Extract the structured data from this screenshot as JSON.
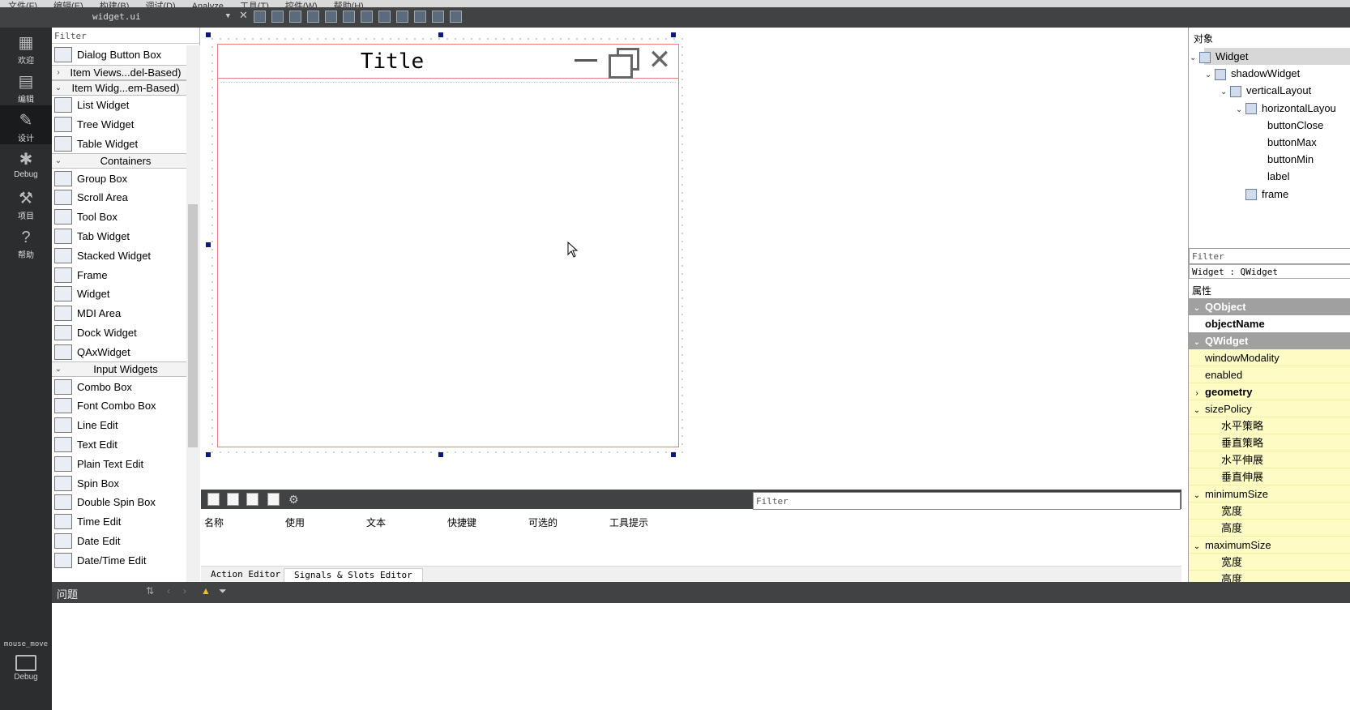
{
  "menubar": {
    "items": [
      "文件(F)",
      "编辑(E)",
      "构建(B)",
      "调试(D)",
      "Analyze",
      "工具(T)",
      "控件(W)",
      "帮助(H)"
    ]
  },
  "toolbar": {
    "file": "widget.ui",
    "close": "✕"
  },
  "modes": [
    {
      "label": "欢迎",
      "icon": "grid-icon"
    },
    {
      "label": "编辑",
      "icon": "edit-doc-icon"
    },
    {
      "label": "设计",
      "icon": "pencil-icon"
    },
    {
      "label": "Debug",
      "icon": "bug-icon"
    },
    {
      "label": "项目",
      "icon": "wrench-icon"
    },
    {
      "label": "帮助",
      "icon": "help-icon"
    }
  ],
  "target": {
    "project": "mouse_move",
    "config": "Debug"
  },
  "widgetbox": {
    "filter": "Filter",
    "items": [
      {
        "type": "item",
        "label": "Dialog Button Box"
      },
      {
        "type": "cat",
        "label": "Item Views...del-Based)",
        "collapsed": true
      },
      {
        "type": "cat",
        "label": "Item Widg...em-Based)",
        "collapsed": false
      },
      {
        "type": "item",
        "label": "List Widget"
      },
      {
        "type": "item",
        "label": "Tree Widget"
      },
      {
        "type": "item",
        "label": "Table Widget"
      },
      {
        "type": "cat",
        "label": "Containers",
        "collapsed": false
      },
      {
        "type": "item",
        "label": "Group Box"
      },
      {
        "type": "item",
        "label": "Scroll Area"
      },
      {
        "type": "item",
        "label": "Tool Box"
      },
      {
        "type": "item",
        "label": "Tab Widget"
      },
      {
        "type": "item",
        "label": "Stacked Widget"
      },
      {
        "type": "item",
        "label": "Frame"
      },
      {
        "type": "item",
        "label": "Widget"
      },
      {
        "type": "item",
        "label": "MDI Area"
      },
      {
        "type": "item",
        "label": "Dock Widget"
      },
      {
        "type": "item",
        "label": "QAxWidget"
      },
      {
        "type": "cat",
        "label": "Input Widgets",
        "collapsed": false
      },
      {
        "type": "item",
        "label": "Combo Box"
      },
      {
        "type": "item",
        "label": "Font Combo Box"
      },
      {
        "type": "item",
        "label": "Line Edit"
      },
      {
        "type": "item",
        "label": "Text Edit"
      },
      {
        "type": "item",
        "label": "Plain Text Edit"
      },
      {
        "type": "item",
        "label": "Spin Box"
      },
      {
        "type": "item",
        "label": "Double Spin Box"
      },
      {
        "type": "item",
        "label": "Time Edit"
      },
      {
        "type": "item",
        "label": "Date Edit"
      },
      {
        "type": "item",
        "label": "Date/Time Edit"
      }
    ]
  },
  "form": {
    "title": "Title"
  },
  "action_editor": {
    "filter": "Filter",
    "columns": [
      "名称",
      "使用",
      "文本",
      "快捷键",
      "可选的",
      "工具提示"
    ],
    "tabs": [
      "Action Editor",
      "Signals & Slots Editor"
    ]
  },
  "object_inspector": {
    "header": "对象",
    "tree": [
      {
        "label": "Widget",
        "depth": 0,
        "chevron": "v",
        "selected": true
      },
      {
        "label": "shadowWidget",
        "depth": 1,
        "chevron": "v"
      },
      {
        "label": "verticalLayout",
        "depth": 2,
        "chevron": "v"
      },
      {
        "label": "horizontalLayou",
        "depth": 3,
        "chevron": "v"
      },
      {
        "label": "buttonClose",
        "depth": 4
      },
      {
        "label": "buttonMax",
        "depth": 4
      },
      {
        "label": "buttonMin",
        "depth": 4
      },
      {
        "label": "label",
        "depth": 4
      },
      {
        "label": "frame",
        "depth": 3
      }
    ]
  },
  "property_editor": {
    "filter": "Filter",
    "class_line": "Widget : QWidget",
    "header": "属性",
    "rows": [
      {
        "label": "QObject",
        "kind": "group"
      },
      {
        "label": "objectName",
        "kind": "bold"
      },
      {
        "label": "QWidget",
        "kind": "group"
      },
      {
        "label": "windowModality",
        "kind": "yellow"
      },
      {
        "label": "enabled",
        "kind": "yellow"
      },
      {
        "label": "geometry",
        "kind": "yellow-bold",
        "chevron": ">"
      },
      {
        "label": "sizePolicy",
        "kind": "yellow",
        "chevron": "v"
      },
      {
        "label": "水平策略",
        "kind": "yellow-sub"
      },
      {
        "label": "垂直策略",
        "kind": "yellow-sub"
      },
      {
        "label": "水平伸展",
        "kind": "yellow-sub"
      },
      {
        "label": "垂直伸展",
        "kind": "yellow-sub"
      },
      {
        "label": "minimumSize",
        "kind": "yellow",
        "chevron": "v"
      },
      {
        "label": "宽度",
        "kind": "yellow-sub"
      },
      {
        "label": "高度",
        "kind": "yellow-sub"
      },
      {
        "label": "maximumSize",
        "kind": "yellow",
        "chevron": "v"
      },
      {
        "label": "宽度",
        "kind": "yellow-sub"
      },
      {
        "label": "高度",
        "kind": "yellow-sub"
      }
    ]
  },
  "issues": {
    "label": "问题"
  }
}
